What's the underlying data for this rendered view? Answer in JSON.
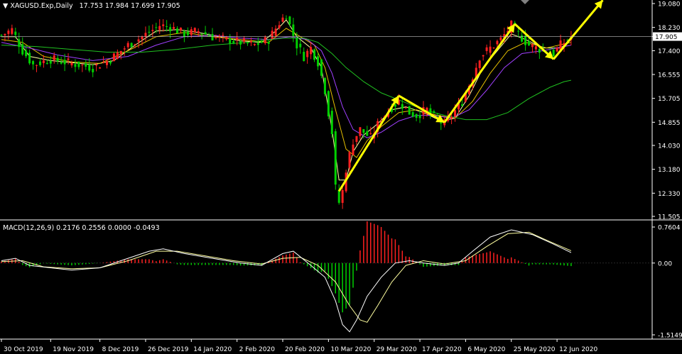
{
  "header": {
    "arrow": "▼",
    "symbol": "XAGUSD.Exp,Daily",
    "ohlc": "17.753 17.984 17.699 17.905"
  },
  "macd_header": "MACD(12,26,9) 0.2176 0.2556 0.0000 -0.0493",
  "colors": {
    "background": "#000000",
    "bull": "#ff2020",
    "bear": "#00d000",
    "ma_fast": "#ffffa0",
    "ma_mid": "#e6c000",
    "ma_slow": "#a040ff",
    "ma_long": "#20c020",
    "macd_signal": "#ffffa0",
    "macd_line": "#ffffff",
    "trend_arrows": "#ffff00"
  },
  "chart_data": [
    {
      "type": "candlestick",
      "title": "XAGUSD.Exp,Daily",
      "current_price": "17.905",
      "yticks": [
        "19.080",
        "18.230",
        "17.905",
        "17.400",
        "16.555",
        "15.705",
        "14.855",
        "14.030",
        "13.180",
        "12.330",
        "11.505"
      ],
      "ylim": [
        11.505,
        19.08
      ],
      "xticks": [
        "30 Oct 2019",
        "19 Nov 2019",
        "8 Dec 2019",
        "26 Dec 2019",
        "14 Jan 2020",
        "2 Feb 2020",
        "20 Feb 2020",
        "10 Mar 2020",
        "29 Mar 2020",
        "17 Apr 2020",
        "6 May 2020",
        "25 May 2020",
        "12 Jun 2020"
      ],
      "close_path": [
        [
          0,
          17.95
        ],
        [
          3,
          18.15
        ],
        [
          6,
          17.4
        ],
        [
          9,
          16.9
        ],
        [
          14,
          17.1
        ],
        [
          20,
          16.95
        ],
        [
          26,
          16.8
        ],
        [
          31,
          17.1
        ],
        [
          36,
          17.6
        ],
        [
          40,
          17.9
        ],
        [
          45,
          18.3
        ],
        [
          48,
          18.25
        ],
        [
          52,
          18.0
        ],
        [
          56,
          18.1
        ],
        [
          60,
          17.9
        ],
        [
          64,
          17.8
        ],
        [
          68,
          17.7
        ],
        [
          72,
          17.6
        ],
        [
          76,
          17.8
        ],
        [
          79,
          18.4
        ],
        [
          81,
          18.7
        ],
        [
          82,
          18.3
        ],
        [
          84,
          17.6
        ],
        [
          86,
          17.2
        ],
        [
          88,
          17.5
        ],
        [
          90,
          17.0
        ],
        [
          92,
          16.0
        ],
        [
          93,
          15.2
        ],
        [
          94,
          14.5
        ],
        [
          95,
          12.5
        ],
        [
          96,
          12.0
        ],
        [
          97,
          12.4
        ],
        [
          98,
          13.2
        ],
        [
          100,
          14.2
        ],
        [
          102,
          14.6
        ],
        [
          105,
          14.3
        ],
        [
          108,
          15.0
        ],
        [
          111,
          15.4
        ],
        [
          113,
          15.6
        ],
        [
          116,
          15.2
        ],
        [
          118,
          15.1
        ],
        [
          121,
          15.3
        ],
        [
          124,
          14.9
        ],
        [
          126,
          14.8
        ],
        [
          128,
          15.1
        ],
        [
          131,
          15.6
        ],
        [
          134,
          16.5
        ],
        [
          136,
          17.2
        ],
        [
          139,
          17.5
        ],
        [
          142,
          17.8
        ],
        [
          145,
          18.3
        ],
        [
          147,
          18.0
        ],
        [
          150,
          17.6
        ],
        [
          152,
          17.5
        ],
        [
          155,
          17.4
        ],
        [
          157,
          17.3
        ],
        [
          159,
          17.6
        ],
        [
          162,
          17.9
        ]
      ],
      "moving_averages": [
        {
          "color_key": "ma_fast",
          "path": [
            [
              0,
              17.9
            ],
            [
              4,
              17.9
            ],
            [
              8,
              17.2
            ],
            [
              14,
              17.05
            ],
            [
              20,
              16.98
            ],
            [
              26,
              16.9
            ],
            [
              32,
              17.05
            ],
            [
              38,
              17.6
            ],
            [
              44,
              18.1
            ],
            [
              50,
              18.15
            ],
            [
              56,
              18.05
            ],
            [
              62,
              17.9
            ],
            [
              68,
              17.75
            ],
            [
              74,
              17.7
            ],
            [
              78,
              18.1
            ],
            [
              81,
              18.5
            ],
            [
              84,
              17.9
            ],
            [
              88,
              17.5
            ],
            [
              91,
              16.8
            ],
            [
              94,
              14.6
            ],
            [
              96,
              12.8
            ],
            [
              98,
              12.8
            ],
            [
              100,
              13.8
            ],
            [
              103,
              14.4
            ],
            [
              107,
              14.8
            ],
            [
              111,
              15.3
            ],
            [
              115,
              15.4
            ],
            [
              120,
              15.2
            ],
            [
              125,
              14.9
            ],
            [
              129,
              15.0
            ],
            [
              133,
              15.8
            ],
            [
              137,
              16.8
            ],
            [
              141,
              17.4
            ],
            [
              145,
              18.0
            ],
            [
              149,
              17.8
            ],
            [
              154,
              17.5
            ],
            [
              159,
              17.5
            ],
            [
              162,
              17.8
            ]
          ]
        },
        {
          "color_key": "ma_mid",
          "path": [
            [
              0,
              17.8
            ],
            [
              6,
              17.7
            ],
            [
              12,
              17.2
            ],
            [
              20,
              17.0
            ],
            [
              28,
              16.95
            ],
            [
              36,
              17.4
            ],
            [
              44,
              17.9
            ],
            [
              52,
              18.05
            ],
            [
              60,
              17.9
            ],
            [
              68,
              17.8
            ],
            [
              76,
              17.7
            ],
            [
              81,
              18.2
            ],
            [
              85,
              17.9
            ],
            [
              89,
              17.6
            ],
            [
              92,
              16.8
            ],
            [
              95,
              15.3
            ],
            [
              98,
              13.9
            ],
            [
              101,
              13.6
            ],
            [
              104,
              14.2
            ],
            [
              108,
              14.7
            ],
            [
              113,
              15.2
            ],
            [
              118,
              15.3
            ],
            [
              124,
              15.1
            ],
            [
              129,
              15.0
            ],
            [
              134,
              15.6
            ],
            [
              139,
              16.6
            ],
            [
              144,
              17.4
            ],
            [
              149,
              17.7
            ],
            [
              155,
              17.5
            ],
            [
              162,
              17.7
            ]
          ]
        },
        {
          "color_key": "ma_slow",
          "path": [
            [
              0,
              17.7
            ],
            [
              8,
              17.5
            ],
            [
              16,
              17.25
            ],
            [
              26,
              17.05
            ],
            [
              36,
              17.2
            ],
            [
              44,
              17.6
            ],
            [
              52,
              17.9
            ],
            [
              60,
              17.95
            ],
            [
              68,
              17.85
            ],
            [
              76,
              17.8
            ],
            [
              82,
              17.9
            ],
            [
              87,
              17.8
            ],
            [
              91,
              17.4
            ],
            [
              94,
              16.6
            ],
            [
              97,
              15.4
            ],
            [
              100,
              14.6
            ],
            [
              104,
              14.3
            ],
            [
              108,
              14.5
            ],
            [
              113,
              14.9
            ],
            [
              118,
              15.1
            ],
            [
              123,
              15.1
            ],
            [
              128,
              15.0
            ],
            [
              133,
              15.3
            ],
            [
              138,
              16.0
            ],
            [
              143,
              16.8
            ],
            [
              148,
              17.3
            ],
            [
              154,
              17.4
            ],
            [
              162,
              17.6
            ]
          ]
        },
        {
          "color_key": "ma_long",
          "path": [
            [
              0,
              17.6
            ],
            [
              10,
              17.55
            ],
            [
              20,
              17.45
            ],
            [
              30,
              17.35
            ],
            [
              40,
              17.35
            ],
            [
              50,
              17.45
            ],
            [
              60,
              17.6
            ],
            [
              70,
              17.7
            ],
            [
              80,
              17.85
            ],
            [
              86,
              17.85
            ],
            [
              90,
              17.7
            ],
            [
              94,
              17.3
            ],
            [
              98,
              16.8
            ],
            [
              103,
              16.3
            ],
            [
              108,
              15.9
            ],
            [
              114,
              15.6
            ],
            [
              120,
              15.3
            ],
            [
              126,
              15.1
            ],
            [
              132,
              14.95
            ],
            [
              138,
              14.95
            ],
            [
              144,
              15.2
            ],
            [
              150,
              15.7
            ],
            [
              156,
              16.1
            ],
            [
              160,
              16.3
            ],
            [
              162,
              16.35
            ]
          ]
        }
      ],
      "trend_arrows": [
        [
          [
            96,
            12.4
          ],
          [
            113,
            15.8
          ]
        ],
        [
          [
            113,
            15.8
          ],
          [
            126,
            14.85
          ]
        ],
        [
          [
            126,
            14.85
          ],
          [
            146,
            18.35
          ]
        ],
        [
          [
            146,
            18.35
          ],
          [
            157,
            17.1
          ]
        ],
        [
          [
            157,
            17.1
          ],
          [
            171,
            19.2
          ]
        ]
      ]
    },
    {
      "type": "bar",
      "title": "MACD(12,26,9)",
      "values_header": "0.2176 0.2556 0.0000 -0.0493",
      "yticks": [
        "0.7604",
        "0.00",
        "-1.5149"
      ],
      "ylim": [
        -1.5149,
        0.7604
      ],
      "macd_path": [
        [
          0,
          0.05
        ],
        [
          4,
          0.1
        ],
        [
          8,
          -0.05
        ],
        [
          14,
          -0.1
        ],
        [
          20,
          -0.15
        ],
        [
          28,
          -0.1
        ],
        [
          36,
          0.1
        ],
        [
          42,
          0.25
        ],
        [
          46,
          0.3
        ],
        [
          52,
          0.2
        ],
        [
          60,
          0.1
        ],
        [
          68,
          0.0
        ],
        [
          74,
          -0.05
        ],
        [
          80,
          0.2
        ],
        [
          83,
          0.25
        ],
        [
          88,
          -0.05
        ],
        [
          92,
          -0.3
        ],
        [
          95,
          -0.8
        ],
        [
          97,
          -1.3
        ],
        [
          99,
          -1.45
        ],
        [
          101,
          -1.2
        ],
        [
          104,
          -0.7
        ],
        [
          108,
          -0.3
        ],
        [
          112,
          0.0
        ],
        [
          116,
          0.05
        ],
        [
          120,
          0.0
        ],
        [
          126,
          -0.05
        ],
        [
          130,
          0.0
        ],
        [
          134,
          0.25
        ],
        [
          139,
          0.55
        ],
        [
          145,
          0.7
        ],
        [
          151,
          0.6
        ],
        [
          157,
          0.4
        ],
        [
          162,
          0.22
        ]
      ],
      "signal_path": [
        [
          0,
          0.03
        ],
        [
          6,
          0.05
        ],
        [
          12,
          -0.08
        ],
        [
          20,
          -0.12
        ],
        [
          28,
          -0.1
        ],
        [
          36,
          0.05
        ],
        [
          44,
          0.25
        ],
        [
          50,
          0.25
        ],
        [
          58,
          0.15
        ],
        [
          66,
          0.05
        ],
        [
          74,
          -0.02
        ],
        [
          80,
          0.1
        ],
        [
          85,
          0.12
        ],
        [
          90,
          -0.05
        ],
        [
          95,
          -0.4
        ],
        [
          99,
          -0.9
        ],
        [
          102,
          -1.2
        ],
        [
          104,
          -1.25
        ],
        [
          107,
          -0.9
        ],
        [
          111,
          -0.4
        ],
        [
          115,
          -0.05
        ],
        [
          120,
          0.05
        ],
        [
          126,
          -0.02
        ],
        [
          132,
          0.05
        ],
        [
          138,
          0.35
        ],
        [
          144,
          0.62
        ],
        [
          150,
          0.65
        ],
        [
          156,
          0.45
        ],
        [
          162,
          0.26
        ]
      ]
    }
  ]
}
